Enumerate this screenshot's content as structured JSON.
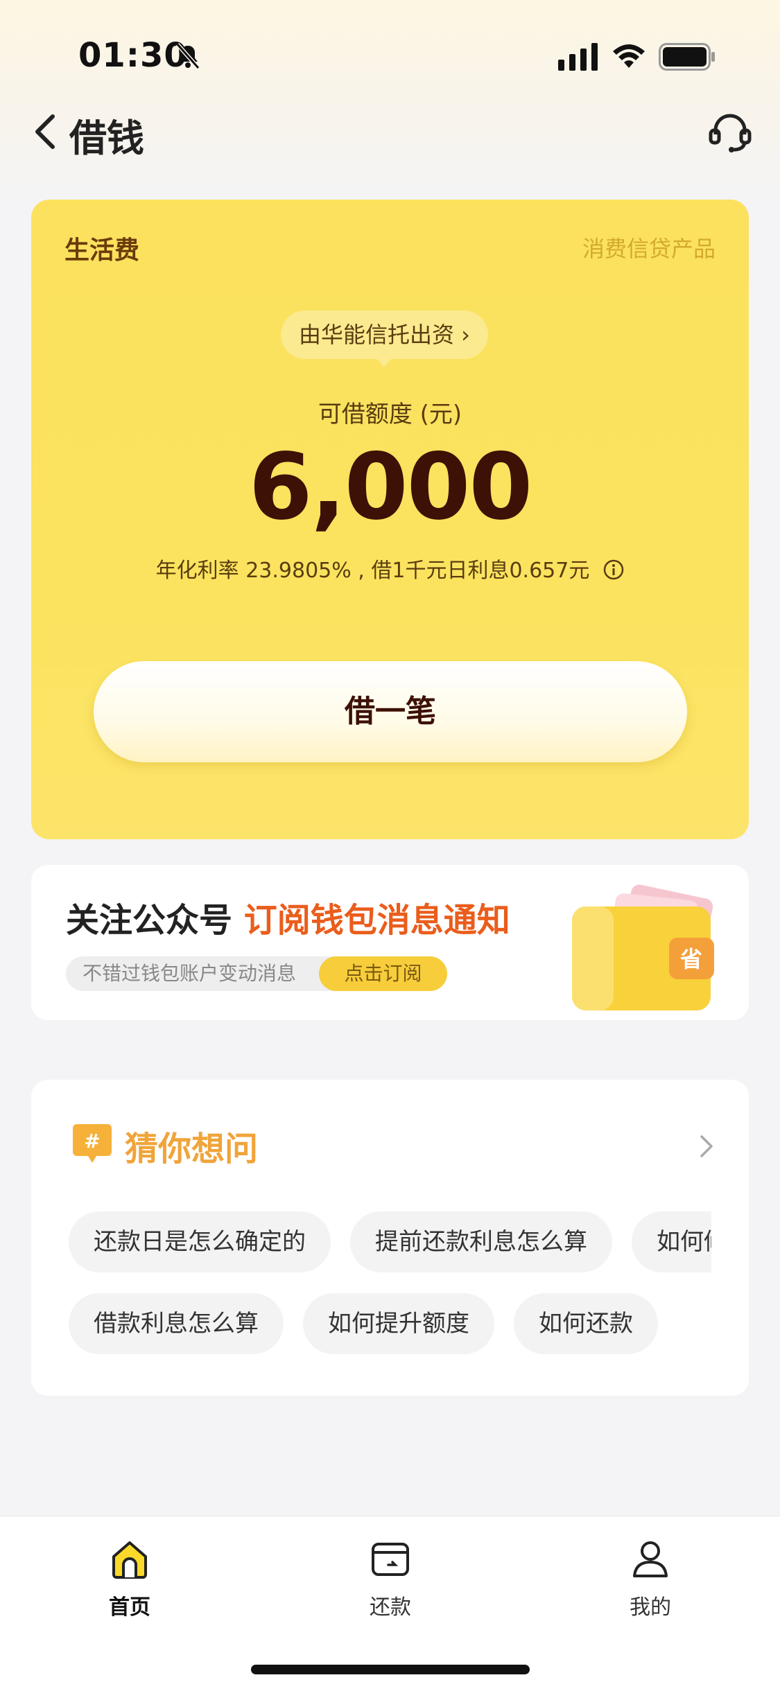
{
  "status_bar": {
    "time": "01:30"
  },
  "nav": {
    "title": "借钱"
  },
  "loan_card": {
    "label": "生活费",
    "product_tag": "消费信贷产品",
    "funder": "由华能信托出资 ›",
    "limit_label": "可借额度 (元)",
    "limit_amount": "6,000",
    "rate_text": "年化利率  23.9805% , 借1千元日利息0.657元",
    "borrow_button": "借一笔"
  },
  "subscribe_banner": {
    "title_prefix": "关注公众号 ",
    "title_highlight": "订阅钱包消息通知",
    "desc": "不错过钱包账户变动消息",
    "button": "点击订阅",
    "icon_char": "省"
  },
  "faq": {
    "title": "猜你想问",
    "row1": [
      "还款日是怎么确定的",
      "提前还款利息怎么算",
      "如何修改还款日"
    ],
    "row2": [
      "借款利息怎么算",
      "如何提升额度",
      "如何还款"
    ]
  },
  "tabbar": {
    "items": [
      {
        "label": "首页",
        "icon": "home-icon"
      },
      {
        "label": "还款",
        "icon": "wallet-icon"
      },
      {
        "label": "我的",
        "icon": "user-icon"
      }
    ]
  },
  "colors": {
    "card_yellow": "#fbe15e",
    "accent_orange": "#ea5d1c",
    "faq_title": "#f0a43a",
    "amount_brown": "#3d1105"
  }
}
